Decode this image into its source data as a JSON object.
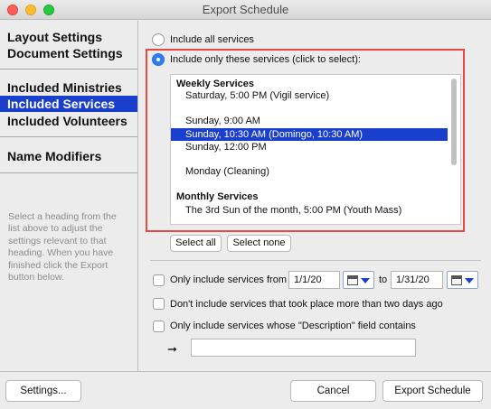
{
  "window": {
    "title": "Export Schedule"
  },
  "sidebar": {
    "items": [
      {
        "label": "Layout Settings"
      },
      {
        "label": "Document Settings"
      },
      {
        "label": "Included Ministries"
      },
      {
        "label": "Included Services"
      },
      {
        "label": "Included Volunteers"
      },
      {
        "label": "Name Modifiers"
      }
    ],
    "selected": "Included Services",
    "help_text": "Select a heading from the list above to adjust the settings relevant to that heading. When you have finished click the Export button below."
  },
  "services": {
    "include_all_label": "Include all services",
    "include_only_label": "Include only these services (click to select):",
    "selected_option": "include_only",
    "list": [
      {
        "type": "heading",
        "text": "Weekly Services"
      },
      {
        "type": "item",
        "text": "Saturday, 5:00 PM (Vigil service)"
      },
      {
        "type": "blank",
        "text": ""
      },
      {
        "type": "item",
        "text": "Sunday, 9:00 AM"
      },
      {
        "type": "item",
        "text": "Sunday, 10:30 AM (Domingo, 10:30 AM)",
        "selected": true
      },
      {
        "type": "item",
        "text": "Sunday, 12:00 PM"
      },
      {
        "type": "blank",
        "text": ""
      },
      {
        "type": "item",
        "text": "Monday (Cleaning)"
      },
      {
        "type": "blank",
        "text": ""
      },
      {
        "type": "heading",
        "text": "Monthly Services"
      },
      {
        "type": "item",
        "text": "The 3rd Sun of the month, 5:00 PM (Youth Mass)"
      }
    ],
    "select_all_label": "Select all",
    "select_none_label": "Select none"
  },
  "filters": {
    "date_range_label": "Only include services from",
    "from_date": "1/1/20",
    "to_label": "to",
    "to_date": "1/31/20",
    "recent_label": "Don't include services that took place more than two days ago",
    "description_label": "Only include services whose \"Description\" field contains",
    "description_value": "",
    "arrow": "➞"
  },
  "footer": {
    "settings_label": "Settings...",
    "cancel_label": "Cancel",
    "export_label": "Export Schedule"
  },
  "colors": {
    "selection": "#1a3fcc",
    "highlight_border": "#e8483e",
    "radio_on": "#2f7cf6"
  }
}
